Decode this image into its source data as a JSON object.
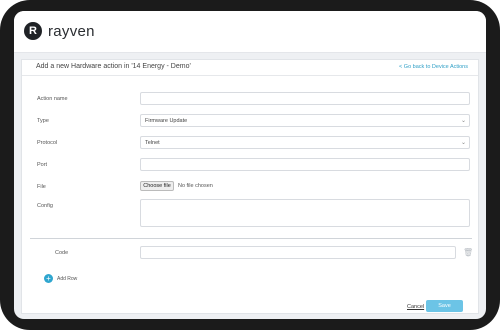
{
  "app": {
    "logo_text": "rayven",
    "logo_mark": "R"
  },
  "form": {
    "title": "Add a new Hardware action in '14 Energy - Demo'",
    "back_link": "< Go back to Device Actions",
    "fields": {
      "action_name": {
        "label": "Action name",
        "value": ""
      },
      "type": {
        "label": "Type",
        "value": "Firmware Update"
      },
      "protocol": {
        "label": "Protocol",
        "value": "Telnet"
      },
      "port": {
        "label": "Port",
        "value": ""
      },
      "file": {
        "label": "File",
        "button": "Choose file",
        "status": "No file chosen"
      },
      "config": {
        "label": "Config",
        "value": ""
      },
      "code": {
        "label": "Code",
        "value": ""
      }
    },
    "add_row": "Add Row",
    "cancel": "Cancel",
    "save": "Save"
  },
  "icons": {
    "trash": "trash-icon",
    "add": "plus-circle-icon",
    "chevron": "chevron-down-icon"
  },
  "colors": {
    "accent": "#2fa6cf",
    "save_button": "#6cc4e6",
    "link": "#2f9fc6"
  }
}
